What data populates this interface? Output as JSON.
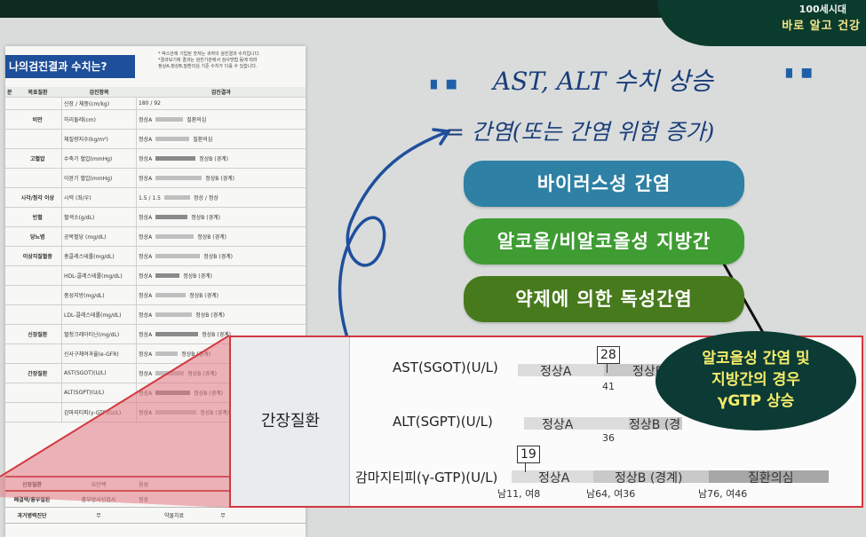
{
  "header": {
    "title_prefix": "",
    "title_highlight": "",
    "brand_top": "100세시대",
    "brand_bottom": "바로 알고 건강"
  },
  "doc": {
    "heading": "나의검진결과 수치는?",
    "note": "* 박스안에 기입된 숫자는 귀하의 검진결과 수치입니다.\n*결과보기에 결과는 검진기관에서 검사방법 등에 따라\n정상A,정상B,질환의심 기준 수치가 다를 수 있습니다.",
    "columns": [
      "분",
      "목표질환",
      "검진항목",
      "검진결과"
    ],
    "rows": [
      {
        "cat": "",
        "item": "신장 / 체중(cm/kg)",
        "val": "180 / 92"
      },
      {
        "cat": "비만",
        "item": "허리둘레(cm)",
        "val": "정상A",
        "val2": "질환의심"
      },
      {
        "cat": "",
        "item": "체질량지수(kg/m²)",
        "val": "정상A",
        "val2": "질환의심"
      },
      {
        "cat": "고혈압",
        "item": "수축기 혈압(mmHg)",
        "val": "정상A",
        "val2": "정상B (경계)"
      },
      {
        "cat": "",
        "item": "이완기 혈압(mmHg)",
        "val": "정상A",
        "val2": "정상B (경계)"
      },
      {
        "cat": "시각/청각 이상",
        "item": "시력 (좌/우)",
        "val": "1.5 / 1.5",
        "val2": "정상 / 정상"
      },
      {
        "cat": "빈혈",
        "item": "혈색소(g/dL)",
        "val": "정상A",
        "val2": "정상B (경계)"
      },
      {
        "cat": "당뇨병",
        "item": "공복혈당 (mg/dL)",
        "val": "정상A",
        "val2": "정상B (경계)"
      },
      {
        "cat": "이상지질혈증",
        "item": "총콜레스테롤(mg/dL)",
        "val": "정상A",
        "val2": "정상B (경계)"
      },
      {
        "cat": "",
        "item": "HDL-콜레스테롤(mg/dL)",
        "val": "정상A",
        "val2": "정상B (경계)"
      },
      {
        "cat": "",
        "item": "중성지방(mg/dL)",
        "val": "정상A",
        "val2": "정상B (경계)"
      },
      {
        "cat": "",
        "item": "LDL-콜레스테롤(mg/dL)",
        "val": "정상A",
        "val2": "정상B (경계)"
      },
      {
        "cat": "신장질환",
        "item": "혈청크레아티닌(mg/dL)",
        "val": "정상A",
        "val2": "정상B (경계)"
      },
      {
        "cat": "",
        "item": "신사구체여과율(e-GFR)",
        "val": "정상A",
        "val2": "정상B (경계)"
      },
      {
        "cat": "간장질환",
        "item": "AST(SGOT)(U/L)",
        "val": "정상A",
        "val2": "정상B (경계)"
      },
      {
        "cat": "",
        "item": "ALT(SGPT)(U/L)",
        "val": "정상A",
        "val2": "정상B (경계)"
      },
      {
        "cat": "",
        "item": "감마지티피(γ-GTP)(U/L)",
        "val": "정상A",
        "val2": "정상B (경계)"
      }
    ],
    "bottom_rows": [
      {
        "a": "신장질환",
        "b": "요단백",
        "c": "음성"
      },
      {
        "a": "폐결핵/흉부질환",
        "b": "흉부방사선검사",
        "c": "정상"
      },
      {
        "a": "과거병력진단",
        "b": "무",
        "c": "약물치료",
        "d": "무"
      }
    ]
  },
  "headline": {
    "line1": "AST, ALT 수치 상승",
    "line2": "= 간염(또는 간염 위험 증가)"
  },
  "pills": {
    "p1": "바이러스성 간염",
    "p2": "알코올/비알코올성 지방간",
    "p3": "약제에 의한 독성간염"
  },
  "panel": {
    "category": "간장질환",
    "ast": {
      "label": "AST(SGOT)(U/L)",
      "box": "28",
      "normA": "정상A",
      "normB": "정상B",
      "threshold": "41"
    },
    "alt": {
      "label": "ALT(SGPT)(U/L)",
      "normA": "정상A",
      "normB": "정상B (경",
      "threshold": "36"
    },
    "ggt": {
      "label": "감마지티피(γ-GTP)(U/L)",
      "box": "19",
      "normA": "정상A",
      "normB": "정상B (경계)",
      "disease": "질환의심",
      "t1": "남11, 여8",
      "t2": "남64, 여36",
      "t3": "남76, 여46"
    }
  },
  "callout": {
    "line1": "알코올성 간염 및",
    "line2": "지방간의 경우",
    "line3": "γGTP 상승"
  },
  "colors": {
    "accent_red": "#d23840",
    "pill1": "#2e80a4",
    "pill2": "#3f9c33",
    "pill3": "#477a1c",
    "callout_bg": "#0b3b34",
    "callout_text": "#f6ec6b",
    "doc_header": "#1e4f9a"
  }
}
